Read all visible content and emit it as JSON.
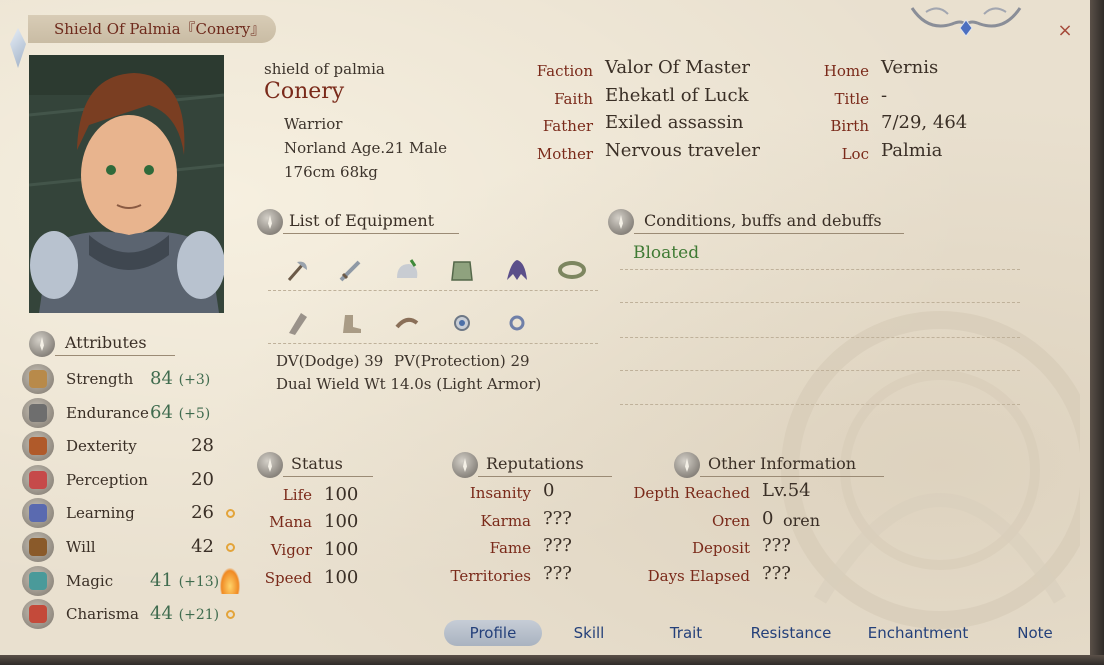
{
  "window": {
    "title": "Shield Of Palmia『Conery』"
  },
  "character": {
    "alias": "shield of palmia",
    "name": "Conery",
    "class": "Warrior",
    "origin": "Norland Age.21 Male",
    "size": "176cm 68kg"
  },
  "bio": {
    "faction_label": "Faction",
    "faction": "Valor Of Master",
    "faith_label": "Faith",
    "faith": "Ehekatl of Luck",
    "father_label": "Father",
    "father": "Exiled assassin",
    "mother_label": "Mother",
    "mother": "Nervous traveler",
    "home_label": "Home",
    "home": "Vernis",
    "title_label": "Title",
    "title": "-",
    "birth_label": "Birth",
    "birth": "7/29, 464",
    "loc_label": "Loc",
    "loc": "Palmia"
  },
  "equipment": {
    "heading": "List of Equipment",
    "icons": [
      "axe-icon",
      "sword-icon",
      "helmet-icon",
      "body-armor-icon",
      "cloak-icon",
      "girdle-icon",
      "gauntlet-icon",
      "boots-icon",
      "bow-icon",
      "amulet-icon",
      "ring-icon"
    ],
    "dv": "DV(Dodge) 39",
    "pv": "PV(Protection) 29",
    "wield": "Dual Wield Wt 14.0s (Light Armor)"
  },
  "conditions": {
    "heading": "Conditions, buffs and debuffs",
    "items": [
      "Bloated"
    ]
  },
  "attributes": {
    "heading": "Attributes",
    "items": [
      {
        "name": "Strength",
        "value": "84",
        "bonus": "(+3)",
        "color": "#3f6b4e",
        "icon": "strength-icon",
        "marker": ""
      },
      {
        "name": "Endurance",
        "value": "64",
        "bonus": "(+5)",
        "color": "#3f6b4e",
        "icon": "endurance-icon",
        "marker": ""
      },
      {
        "name": "Dexterity",
        "value": "28",
        "bonus": "",
        "color": "#3a2f26",
        "icon": "dexterity-icon",
        "marker": ""
      },
      {
        "name": "Perception",
        "value": "20",
        "bonus": "",
        "color": "#3a2f26",
        "icon": "perception-icon",
        "marker": ""
      },
      {
        "name": "Learning",
        "value": "26",
        "bonus": "",
        "color": "#3a2f26",
        "icon": "learning-icon",
        "marker": "potential"
      },
      {
        "name": "Will",
        "value": "42",
        "bonus": "",
        "color": "#3a2f26",
        "icon": "will-icon",
        "marker": "potential"
      },
      {
        "name": "Magic",
        "value": "41",
        "bonus": "(+13)",
        "color": "#3f6b4e",
        "icon": "magic-icon",
        "marker": "flame"
      },
      {
        "name": "Charisma",
        "value": "44",
        "bonus": "(+21)",
        "color": "#3f6b4e",
        "icon": "charisma-icon",
        "marker": "potential"
      }
    ]
  },
  "status": {
    "heading": "Status",
    "items": [
      {
        "label": "Life",
        "value": "100"
      },
      {
        "label": "Mana",
        "value": "100"
      },
      {
        "label": "Vigor",
        "value": "100"
      },
      {
        "label": "Speed",
        "value": "100"
      }
    ]
  },
  "reputations": {
    "heading": "Reputations",
    "items": [
      {
        "label": "Insanity",
        "value": "0"
      },
      {
        "label": "Karma",
        "value": "???"
      },
      {
        "label": "Fame",
        "value": "???"
      },
      {
        "label": "Territories",
        "value": "???"
      }
    ]
  },
  "other": {
    "heading": "Other Information",
    "items": [
      {
        "label": "Depth Reached",
        "value": "Lv.54",
        "unit": ""
      },
      {
        "label": "Oren",
        "value": "0",
        "unit": "oren"
      },
      {
        "label": "Deposit",
        "value": "???",
        "unit": ""
      },
      {
        "label": "Days Elapsed",
        "value": "???",
        "unit": ""
      }
    ]
  },
  "tabs": [
    {
      "label": "Profile",
      "active": true
    },
    {
      "label": "Skill",
      "active": false
    },
    {
      "label": "Trait",
      "active": false
    },
    {
      "label": "Resistance",
      "active": false
    },
    {
      "label": "Enchantment",
      "active": false
    },
    {
      "label": "Note",
      "active": false
    }
  ],
  "close_symbol": "×"
}
